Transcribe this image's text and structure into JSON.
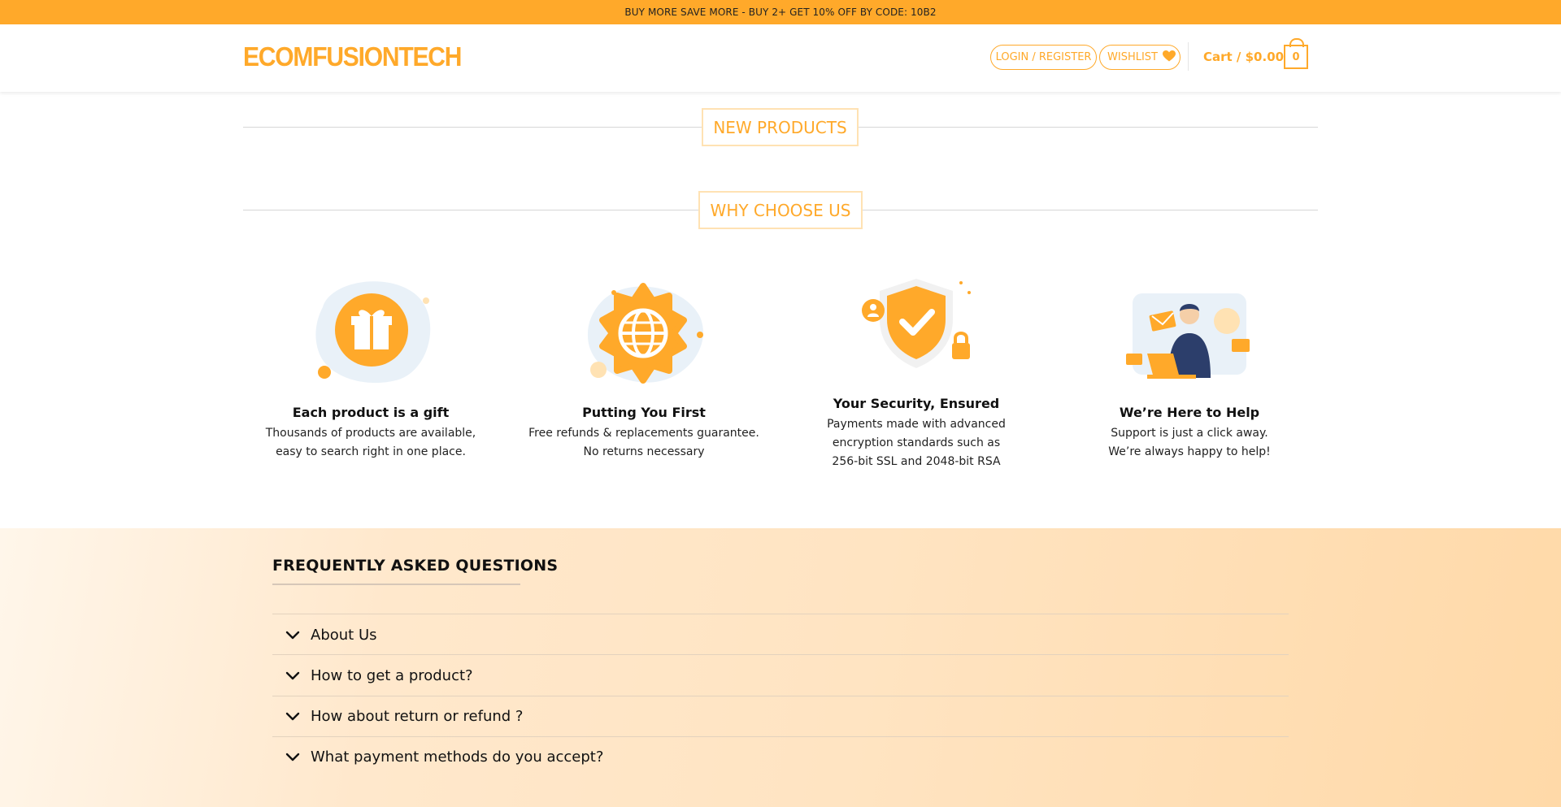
{
  "promo": {
    "text": "BUY MORE SAVE MORE - BUY 2+ GET 10% OFF BY CODE: 10B2"
  },
  "header": {
    "logo": "ECOMFUSIONTECH",
    "login_label": "LOGIN / REGISTER",
    "wishlist_label": "WISHLIST",
    "cart_label": "Cart / $0.00",
    "cart_count": "0"
  },
  "sections": {
    "new_products": "NEW PRODUCTS",
    "why_choose_us": "WHY CHOOSE US"
  },
  "features": [
    {
      "icon": "gift-icon",
      "title": "Each product is a gift",
      "lines": [
        "Thousands of products are available,",
        "easy to search right in one place."
      ]
    },
    {
      "icon": "globe-icon",
      "title": "Putting You First",
      "lines": [
        "Free refunds & replacements guarantee.",
        "No returns necessary"
      ]
    },
    {
      "icon": "shield-check-icon",
      "title": "Your Security, Ensured",
      "lines": [
        "Payments made with advanced",
        "encryption standards such as",
        "256-bit SSL and 2048-bit RSA"
      ]
    },
    {
      "icon": "support-person-icon",
      "title": "We’re Here to Help",
      "lines": [
        "Support is just a click away.",
        "We’re always happy to help!"
      ]
    }
  ],
  "faq": {
    "title": "FREQUENTLY ASKED QUESTIONS",
    "items": [
      "About Us",
      "How to get a product?",
      "How about return or refund ?",
      "What payment methods do you accept?"
    ]
  },
  "colors": {
    "accent": "#ffa92a",
    "accent_light": "#ffe2b3",
    "navy": "#2c3e6b"
  }
}
